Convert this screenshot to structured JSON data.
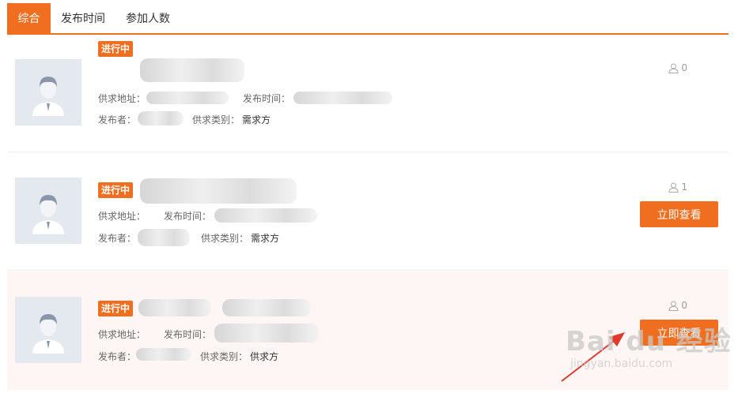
{
  "tabs": [
    {
      "label": "综合",
      "active": true
    },
    {
      "label": "发布时间",
      "active": false
    },
    {
      "label": "参加人数",
      "active": false
    }
  ],
  "colors": {
    "accent": "#f06e1f",
    "avatar_bg": "#e4e8ef",
    "highlight_row_bg": "#fdf6f4"
  },
  "labels": {
    "address": "供求地址：",
    "publish_time": "发布时间：",
    "publisher": "发布者：",
    "category": "供求类别："
  },
  "items": [
    {
      "status": "进行中",
      "category": "需求方",
      "participants": "0",
      "button": ""
    },
    {
      "status": "进行中",
      "category": "需求方",
      "participants": "1",
      "button": "立即查看"
    },
    {
      "status": "进行中",
      "category": "供求方",
      "participants": "0",
      "button": "立即查看"
    }
  ],
  "icons": {
    "avatar": "default-user-avatar-icon",
    "participants": "user-outline-icon"
  },
  "watermark": {
    "brand": "Bai du 经验",
    "url": "jingyan.baidu.com"
  }
}
